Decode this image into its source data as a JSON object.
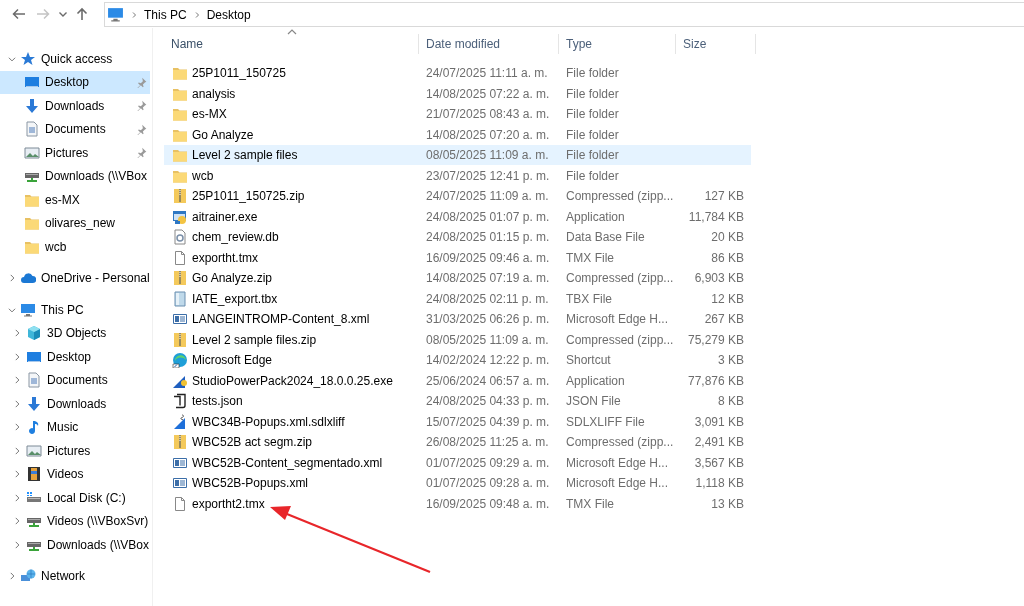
{
  "nav_buttons": [
    {
      "kind": "back",
      "disabled": false
    },
    {
      "kind": "forward",
      "disabled": true
    },
    {
      "kind": "recent",
      "disabled": false
    },
    {
      "kind": "up",
      "disabled": false
    }
  ],
  "address_bar": {
    "segments": [
      "This PC",
      "Desktop"
    ]
  },
  "sidebar": {
    "items": [
      {
        "label": "Quick access",
        "kind": "star",
        "expanded": true,
        "selected": false,
        "children": [
          {
            "label": "Desktop",
            "kind": "desktop",
            "pinned": true,
            "selected": true
          },
          {
            "label": "Downloads",
            "kind": "downloads",
            "pinned": true,
            "selected": false
          },
          {
            "label": "Documents",
            "kind": "documents",
            "pinned": true,
            "selected": false
          },
          {
            "label": "Pictures",
            "kind": "pictures",
            "pinned": true,
            "selected": false
          },
          {
            "label": "Downloads (\\\\VBox",
            "kind": "netdrive",
            "pinned": false,
            "selected": false
          },
          {
            "label": "es-MX",
            "kind": "folder",
            "pinned": false,
            "selected": false
          },
          {
            "label": "olivares_new",
            "kind": "folder",
            "pinned": false,
            "selected": false
          },
          {
            "label": "wcb",
            "kind": "folder",
            "pinned": false,
            "selected": false
          }
        ]
      },
      {
        "label": "OneDrive - Personal",
        "kind": "cloud",
        "expanded": false,
        "selected": false
      },
      {
        "label": "This PC",
        "kind": "pc",
        "expanded": true,
        "selected": false,
        "children": [
          {
            "label": "3D Objects",
            "kind": "cube",
            "expanded": false,
            "selected": false
          },
          {
            "label": "Desktop",
            "kind": "desktop",
            "expanded": false,
            "selected": false
          },
          {
            "label": "Documents",
            "kind": "documents",
            "expanded": false,
            "selected": false
          },
          {
            "label": "Downloads",
            "kind": "downloads",
            "expanded": false,
            "selected": false
          },
          {
            "label": "Music",
            "kind": "music",
            "expanded": false,
            "selected": false
          },
          {
            "label": "Pictures",
            "kind": "pictures",
            "expanded": false,
            "selected": false
          },
          {
            "label": "Videos",
            "kind": "videos",
            "expanded": false,
            "selected": false
          },
          {
            "label": "Local Disk (C:)",
            "kind": "disk",
            "expanded": false,
            "selected": false
          },
          {
            "label": "Videos (\\\\VBoxSvr)",
            "kind": "netdrive",
            "expanded": false,
            "selected": false
          },
          {
            "label": "Downloads (\\\\VBox",
            "kind": "netdrive",
            "expanded": false,
            "selected": false
          }
        ]
      },
      {
        "label": "Network",
        "kind": "network",
        "expanded": false,
        "selected": false
      }
    ]
  },
  "table": {
    "columns": [
      {
        "label": "Name",
        "sorted": true
      },
      {
        "label": "Date modified",
        "sorted": false
      },
      {
        "label": "Type",
        "sorted": false
      },
      {
        "label": "Size",
        "sorted": false
      }
    ],
    "rows": [
      {
        "kind": "folder",
        "name": "25P1011_150725",
        "date": "24/07/2025 11:11 a. m.",
        "type": "File folder",
        "selected": false
      },
      {
        "kind": "folder",
        "name": "analysis",
        "date": "14/08/2025 07:22 a. m.",
        "type": "File folder",
        "selected": false
      },
      {
        "kind": "folder",
        "name": "es-MX",
        "date": "21/07/2025 08:43 a. m.",
        "type": "File folder",
        "selected": false
      },
      {
        "kind": "folder",
        "name": "Go Analyze",
        "date": "14/08/2025 07:20 a. m.",
        "type": "File folder",
        "selected": false
      },
      {
        "kind": "folder",
        "name": "Level 2 sample files",
        "date": "08/05/2025 11:09 a. m.",
        "type": "File folder",
        "selected": true
      },
      {
        "kind": "folder",
        "name": "wcb",
        "date": "23/07/2025 12:41 p. m.",
        "type": "File folder",
        "selected": false
      },
      {
        "kind": "zip",
        "name": "25P1011_150725.zip",
        "date": "24/07/2025 11:09 a. m.",
        "type": "Compressed (zipp...",
        "size": "127 KB",
        "selected": false
      },
      {
        "kind": "exe",
        "name": "aitrainer.exe",
        "date": "24/08/2025 01:07 p. m.",
        "type": "Application",
        "size": "11,784 KB",
        "selected": false
      },
      {
        "kind": "db",
        "name": "chem_review.db",
        "date": "24/08/2025 01:15 p. m.",
        "type": "Data Base File",
        "size": "20 KB",
        "selected": false
      },
      {
        "kind": "file",
        "name": "exportht.tmx",
        "date": "16/09/2025 09:46 a. m.",
        "type": "TMX File",
        "size": "86 KB",
        "selected": false
      },
      {
        "kind": "zip",
        "name": "Go Analyze.zip",
        "date": "14/08/2025 07:19 a. m.",
        "type": "Compressed (zipp...",
        "size": "6,903 KB",
        "selected": false
      },
      {
        "kind": "tbx",
        "name": "IATE_export.tbx",
        "date": "24/08/2025 02:11 p. m.",
        "type": "TBX File",
        "size": "12 KB",
        "selected": false
      },
      {
        "kind": "html",
        "name": "LANGEINTROMP-Content_8.xml",
        "date": "31/03/2025 06:26 p. m.",
        "type": "Microsoft Edge H...",
        "size": "267 KB",
        "selected": false
      },
      {
        "kind": "zip",
        "name": "Level 2 sample files.zip",
        "date": "08/05/2025 11:09 a. m.",
        "type": "Compressed (zipp...",
        "size": "75,279 KB",
        "selected": false
      },
      {
        "kind": "edge",
        "name": "Microsoft Edge",
        "date": "14/02/2024 12:22 p. m.",
        "type": "Shortcut",
        "size": "3 KB",
        "selected": false
      },
      {
        "kind": "installer",
        "name": "StudioPowerPack2024_18.0.0.25.exe",
        "date": "25/06/2024 06:57 a. m.",
        "type": "Application",
        "size": "77,876 KB",
        "selected": false
      },
      {
        "kind": "json",
        "name": "tests.json",
        "date": "24/08/2025 04:33 p. m.",
        "type": "JSON File",
        "size": "8 KB",
        "selected": false
      },
      {
        "kind": "sdl",
        "name": "WBC34B-Popups.xml.sdlxliff",
        "date": "15/07/2025 04:39 p. m.",
        "type": "SDLXLIFF File",
        "size": "3,091 KB",
        "selected": false
      },
      {
        "kind": "zip",
        "name": "WBC52B act segm.zip",
        "date": "26/08/2025 11:25 a. m.",
        "type": "Compressed (zipp...",
        "size": "2,491 KB",
        "selected": false
      },
      {
        "kind": "html",
        "name": "WBC52B-Content_segmentado.xml",
        "date": "01/07/2025 09:29 a. m.",
        "type": "Microsoft Edge H...",
        "size": "3,567 KB",
        "selected": false
      },
      {
        "kind": "html",
        "name": "WBC52B-Popups.xml",
        "date": "01/07/2025 09:28 a. m.",
        "type": "Microsoft Edge H...",
        "size": "1,118 KB",
        "selected": false
      },
      {
        "kind": "file",
        "name": "exportht2.tmx",
        "date": "16/09/2025 09:48 a. m.",
        "type": "TMX File",
        "size": "13 KB",
        "selected": false
      }
    ]
  }
}
